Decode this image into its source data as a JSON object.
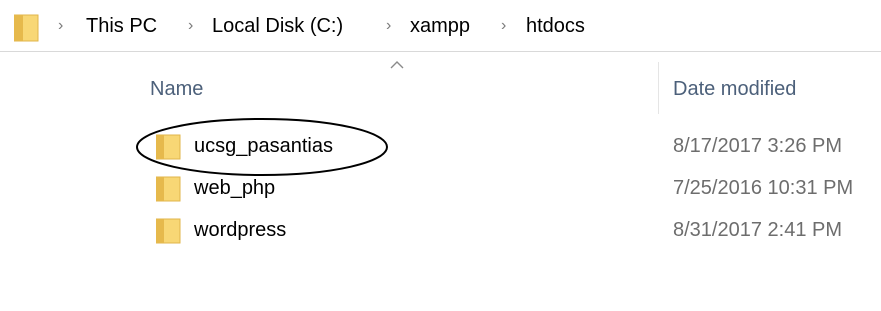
{
  "address_bar": {
    "folder_icon": "folder-icon",
    "separator_icon": "chevron-right-icon",
    "crumbs": [
      "This PC",
      "Local Disk (C:)",
      "xampp",
      "htdocs"
    ]
  },
  "columns": {
    "name": "Name",
    "date_modified": "Date modified",
    "sort_indicator": "sort-ascending-icon"
  },
  "rows": [
    {
      "name": "ucsg_pasantias",
      "date": "8/17/2017 3:26 PM",
      "icon": "folder-icon",
      "circled": true
    },
    {
      "name": "web_php",
      "date": "7/25/2016 10:31 PM",
      "icon": "folder-icon"
    },
    {
      "name": "wordpress",
      "date": "8/31/2017 2:41 PM",
      "icon": "folder-icon"
    }
  ],
  "colors": {
    "folder_fill": "#f8d775",
    "folder_edge": "#e0b64a",
    "header_text": "#4c607a",
    "date_text": "#6d6d6d"
  }
}
